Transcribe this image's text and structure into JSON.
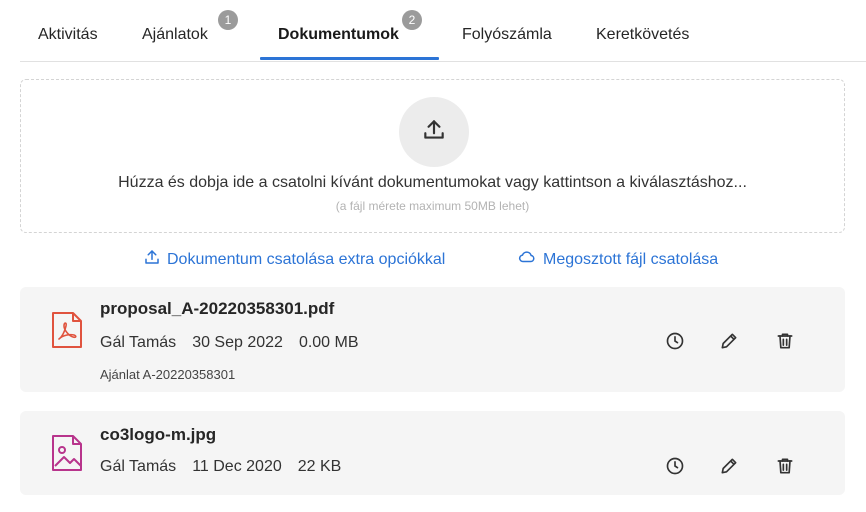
{
  "tabs": [
    {
      "label": "Aktivitás"
    },
    {
      "label": "Ajánlatok",
      "badge": "1"
    },
    {
      "label": "Dokumentumok",
      "badge": "2"
    },
    {
      "label": "Folyószámla"
    },
    {
      "label": "Keretkövetés"
    }
  ],
  "active_tab": "Dokumentumok",
  "dropzone": {
    "main_text": "Húzza és dobja ide a csatolni kívánt dokumentumokat vagy kattintson a kiválasztáshoz...",
    "sub_text": "(a fájl mérete maximum 50MB lehet)",
    "icon": "upload-icon"
  },
  "links": {
    "extra_options": "Dokumentum csatolása extra opciókkal",
    "shared_file": "Megosztott fájl csatolása"
  },
  "files": [
    {
      "name": "proposal_A-20220358301.pdf",
      "author": "Gál Tamás",
      "date": "30 Sep 2022",
      "size": "0.00 MB",
      "related": "Ajánlat A-20220358301",
      "icon": "pdf-file-icon"
    },
    {
      "name": "co3logo-m.jpg",
      "author": "Gál Tamás",
      "date": "11 Dec 2020",
      "size": "22 KB",
      "icon": "image-file-icon"
    }
  ],
  "colors": {
    "accent": "#2c74d6",
    "pdf_icon": "#e0533e",
    "image_icon": "#b8348c",
    "badge": "#9b9b9b"
  }
}
